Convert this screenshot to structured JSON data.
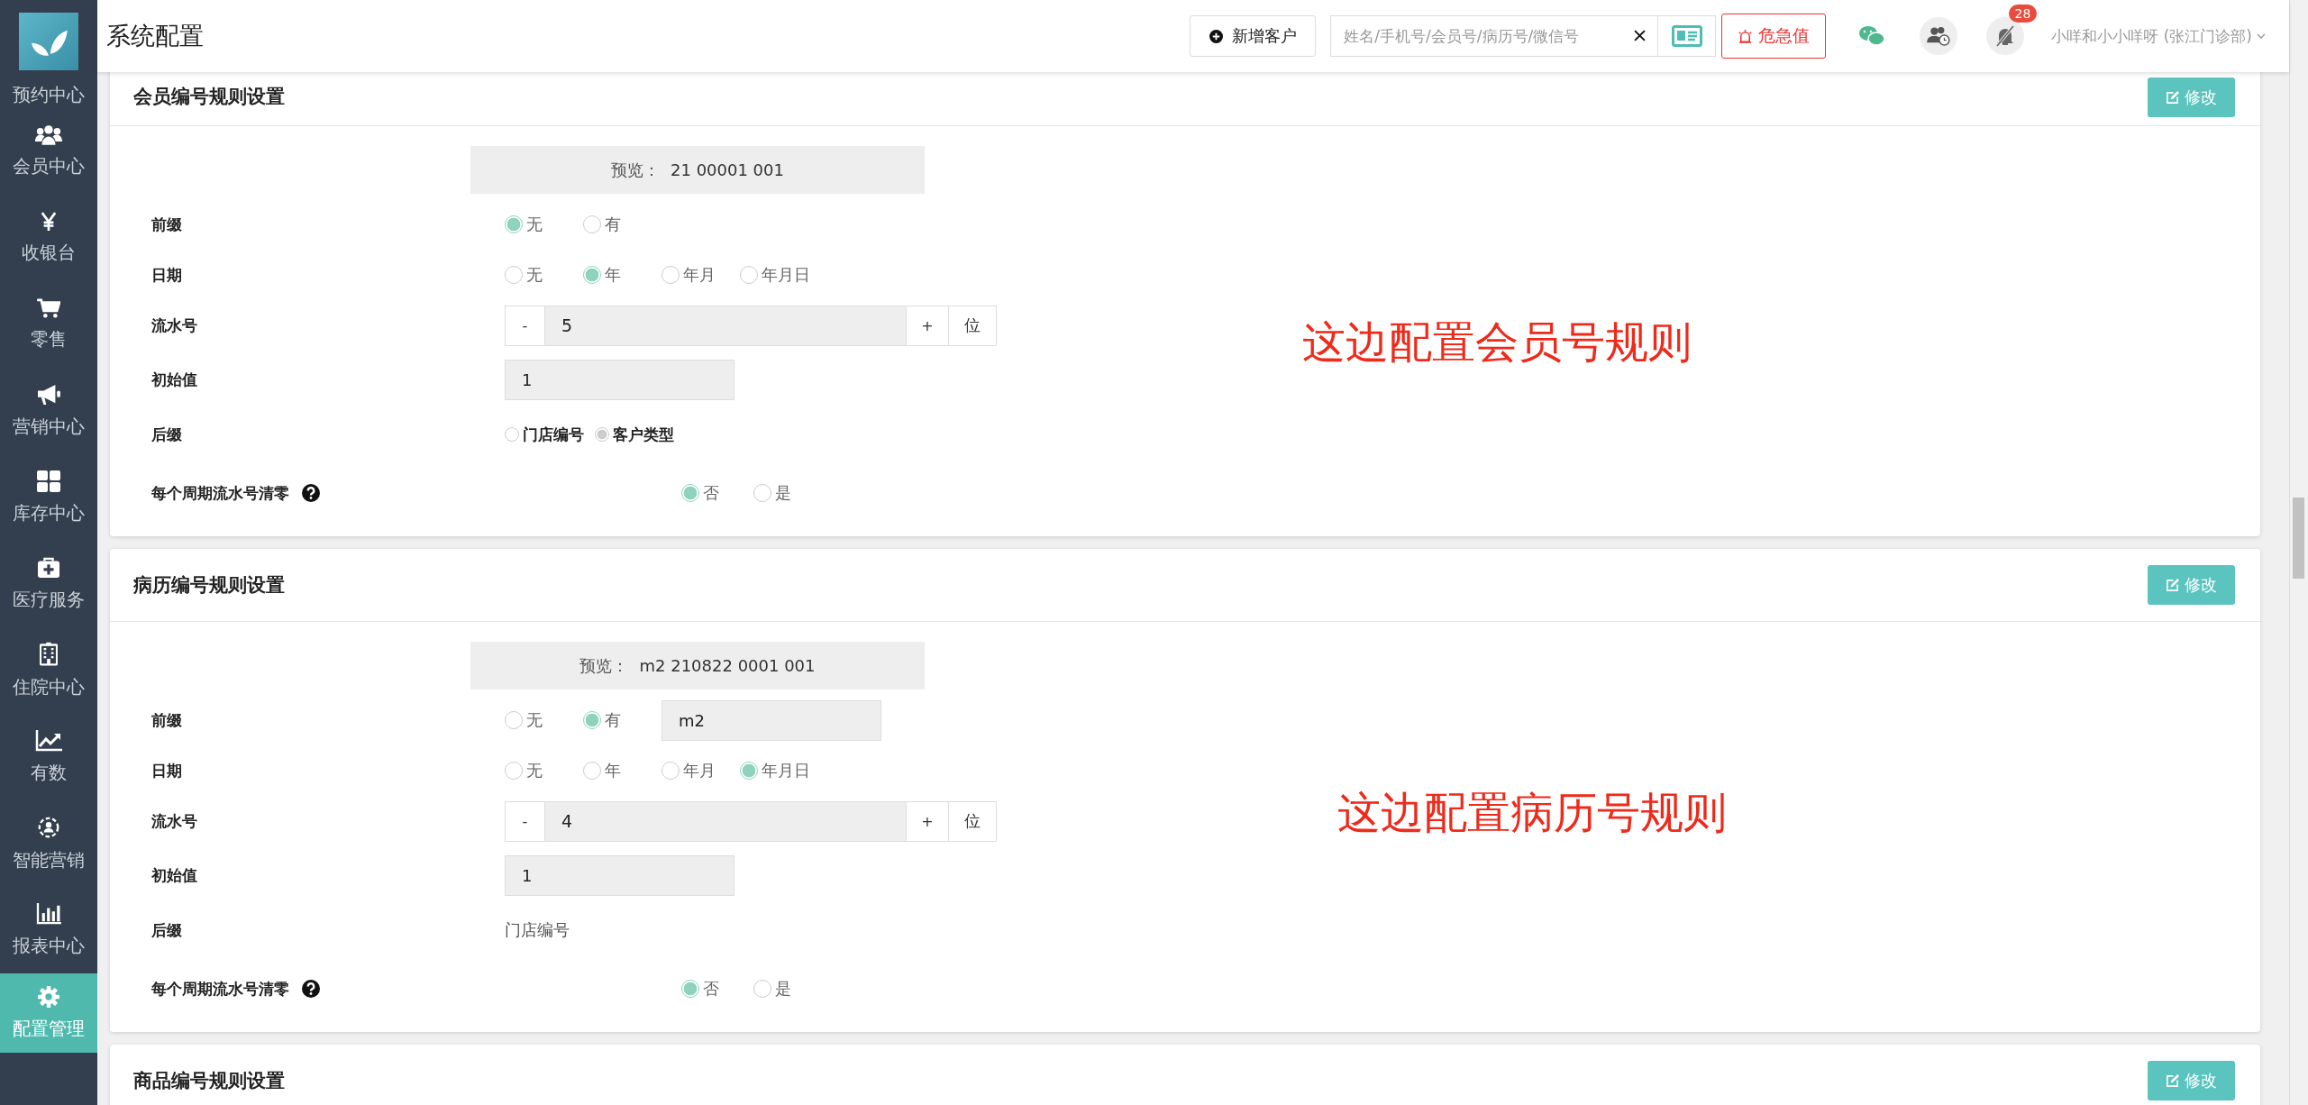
{
  "sidebar": {
    "items": [
      {
        "label": "预约中心",
        "selected": false
      },
      {
        "label": "会员中心",
        "selected": false
      },
      {
        "label": "收银台",
        "selected": false
      },
      {
        "label": "零售",
        "selected": false
      },
      {
        "label": "营销中心",
        "selected": false
      },
      {
        "label": "库存中心",
        "selected": false
      },
      {
        "label": "医疗服务",
        "selected": false
      },
      {
        "label": "住院中心",
        "selected": false
      },
      {
        "label": "有数",
        "selected": false
      },
      {
        "label": "智能营销",
        "selected": false
      },
      {
        "label": "报表中心",
        "selected": false
      },
      {
        "label": "配置管理",
        "selected": true
      }
    ]
  },
  "header": {
    "title": "系统配置",
    "add_button": "新增客户",
    "search": {
      "placeholder": "姓名/手机号/会员号/病历号/微信号"
    },
    "alert_button": "危急值",
    "notification_badge": "28",
    "user": "小咩和小小咩呀 (张江门诊部)"
  },
  "sections": [
    {
      "title": "会员编号规则设置",
      "edit_button": "修改",
      "preview_label": "预览：",
      "preview_value": "21 00001 001",
      "annotation": "这边配置会员号规则",
      "rows": [
        {
          "kind": "radio",
          "label": "前缀",
          "options": [
            {
              "label": "无",
              "selected": true
            },
            {
              "label": "有",
              "selected": false
            }
          ]
        },
        {
          "kind": "radio",
          "label": "日期",
          "options": [
            {
              "label": "无",
              "selected": false
            },
            {
              "label": "年",
              "selected": true
            },
            {
              "label": "年月",
              "selected": false
            },
            {
              "label": "年月日",
              "selected": false
            }
          ]
        },
        {
          "kind": "stepper",
          "label": "流水号",
          "minus": "-",
          "value": "5",
          "plus": "+",
          "unit": "位"
        },
        {
          "kind": "input",
          "label": "初始值",
          "value": "1"
        },
        {
          "kind": "radio_small",
          "label": "后缀",
          "options": [
            {
              "label": "门店编号",
              "selected": false
            },
            {
              "label": "客户类型",
              "selected": true
            }
          ]
        },
        {
          "kind": "radio_help",
          "label": "每个周期流水号清零",
          "options": [
            {
              "label": "否",
              "selected": true
            },
            {
              "label": "是",
              "selected": false
            }
          ]
        }
      ]
    },
    {
      "title": "病历编号规则设置",
      "edit_button": "修改",
      "preview_label": "预览：",
      "preview_value": "m2 210822 0001 001",
      "annotation": "这边配置病历号规则",
      "rows": [
        {
          "kind": "radio",
          "label": "前缀",
          "options": [
            {
              "label": "无",
              "selected": false
            },
            {
              "label": "有",
              "selected": true
            }
          ],
          "value": "m2"
        },
        {
          "kind": "radio",
          "label": "日期",
          "options": [
            {
              "label": "无",
              "selected": false
            },
            {
              "label": "年",
              "selected": false
            },
            {
              "label": "年月",
              "selected": false
            },
            {
              "label": "年月日",
              "selected": true
            }
          ]
        },
        {
          "kind": "stepper",
          "label": "流水号",
          "minus": "-",
          "value": "4",
          "plus": "+",
          "unit": "位"
        },
        {
          "kind": "input",
          "label": "初始值",
          "value": "1"
        },
        {
          "kind": "text",
          "label": "后缀",
          "value": "门店编号"
        },
        {
          "kind": "radio_help",
          "label": "每个周期流水号清零",
          "options": [
            {
              "label": "否",
              "selected": true
            },
            {
              "label": "是",
              "selected": false
            }
          ]
        }
      ]
    },
    {
      "title": "商品编号规则设置",
      "edit_button": "修改"
    }
  ]
}
